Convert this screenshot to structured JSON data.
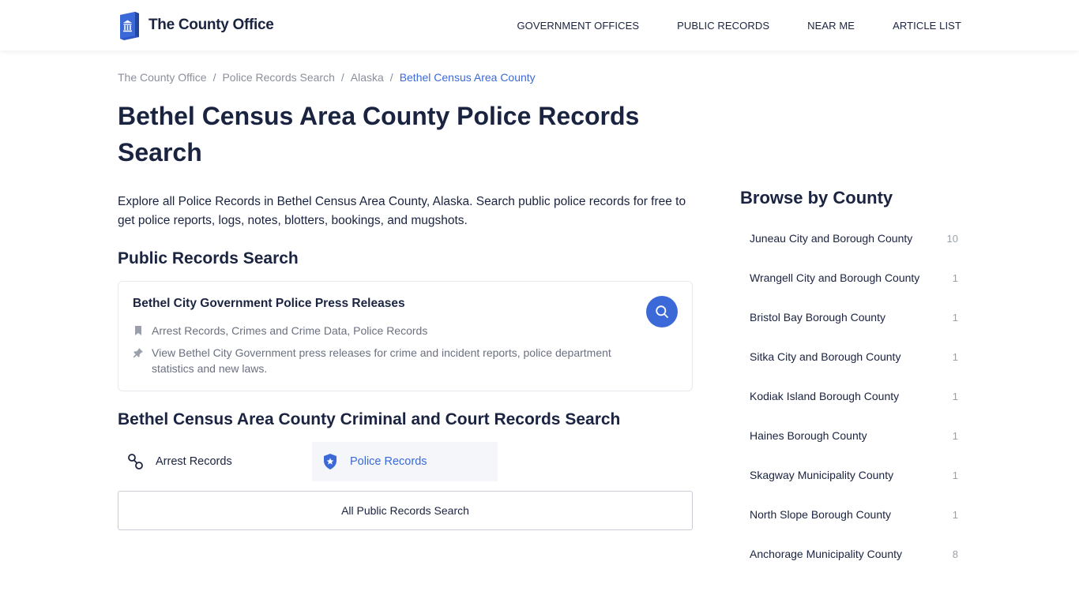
{
  "header": {
    "logo_text": "The County Office",
    "nav": [
      "GOVERNMENT OFFICES",
      "PUBLIC RECORDS",
      "NEAR ME",
      "ARTICLE LIST"
    ]
  },
  "breadcrumb": [
    "The County Office",
    "Police Records Search",
    "Alaska",
    "Bethel Census Area County"
  ],
  "page": {
    "title": "Bethel Census Area County Police Records Search",
    "intro": "Explore all Police Records in Bethel Census Area County, Alaska. Search public police records for free to get police reports, logs, notes, blotters, bookings, and mugshots."
  },
  "public_records": {
    "heading": "Public Records Search",
    "card": {
      "title": "Bethel City Government Police Press Releases",
      "categories": "Arrest Records, Crimes and Crime Data, Police Records",
      "description": "View Bethel City Government press releases for crime and incident reports, police department statistics and new laws."
    }
  },
  "criminal": {
    "heading": "Bethel Census Area County Criminal and Court Records Search",
    "tiles": [
      "Arrest Records",
      "Police Records"
    ],
    "all_button": "All Public Records Search"
  },
  "sidebar": {
    "title": "Browse by County",
    "counties": [
      {
        "name": "Juneau City and Borough County",
        "count": "10"
      },
      {
        "name": "Wrangell City and Borough County",
        "count": "1"
      },
      {
        "name": "Bristol Bay Borough County",
        "count": "1"
      },
      {
        "name": "Sitka City and Borough County",
        "count": "1"
      },
      {
        "name": "Kodiak Island Borough County",
        "count": "1"
      },
      {
        "name": "Haines Borough County",
        "count": "1"
      },
      {
        "name": "Skagway Municipality County",
        "count": "1"
      },
      {
        "name": "North Slope Borough County",
        "count": "1"
      },
      {
        "name": "Anchorage Municipality County",
        "count": "8"
      }
    ]
  },
  "colors": {
    "accent": "#3b6ad8",
    "text": "#1a2340",
    "muted": "#8a8f9c"
  }
}
